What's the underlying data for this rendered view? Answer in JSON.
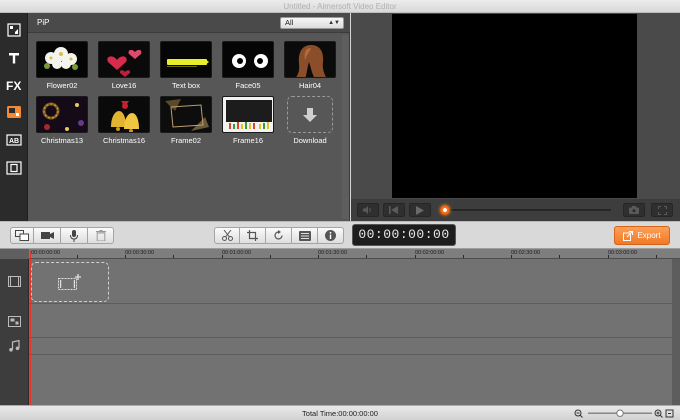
{
  "window": {
    "title": "Untitled - Aimersoft Video Editor"
  },
  "sidebar": {
    "items": [
      {
        "icon": "media-library-icon"
      },
      {
        "icon": "text-icon"
      },
      {
        "icon": "fx-icon"
      },
      {
        "icon": "pip-icon",
        "active": true
      },
      {
        "icon": "transition-icon"
      },
      {
        "icon": "intro-credit-icon"
      }
    ]
  },
  "library": {
    "category": "PiP",
    "filter": {
      "selected": "All"
    },
    "tiles": [
      {
        "label": "Flower02"
      },
      {
        "label": "Love16"
      },
      {
        "label": "Text box"
      },
      {
        "label": "Face05"
      },
      {
        "label": "Hair04"
      },
      {
        "label": "Christmas13"
      },
      {
        "label": "Christmas16"
      },
      {
        "label": "Frame02"
      },
      {
        "label": "Frame16"
      },
      {
        "label": "Download"
      }
    ]
  },
  "timeline": {
    "timecode": "00:00:00:00",
    "ruler": [
      "00:00:00:00",
      "00:00:30:00",
      "00:01:00:00",
      "00:01:30:00",
      "00:02:00:00",
      "00:02:30:00",
      "00:03:00:00"
    ],
    "tracks": [
      "video-track-icon",
      "pip-track-icon",
      "music-track-icon"
    ],
    "total_time": "Total Time:00:00:00:00"
  },
  "toolbar": {
    "export_label": "Export"
  },
  "colors": {
    "accent": "#f28a35",
    "playhead": "#e4352a"
  }
}
